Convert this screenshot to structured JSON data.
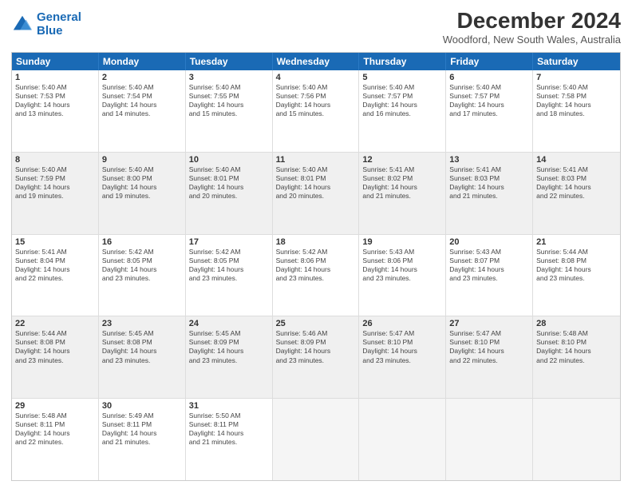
{
  "logo": {
    "line1": "General",
    "line2": "Blue"
  },
  "title": "December 2024",
  "subtitle": "Woodford, New South Wales, Australia",
  "days": [
    "Sunday",
    "Monday",
    "Tuesday",
    "Wednesday",
    "Thursday",
    "Friday",
    "Saturday"
  ],
  "rows": [
    [
      {
        "num": "1",
        "text": "Sunrise: 5:40 AM\nSunset: 7:53 PM\nDaylight: 14 hours\nand 13 minutes."
      },
      {
        "num": "2",
        "text": "Sunrise: 5:40 AM\nSunset: 7:54 PM\nDaylight: 14 hours\nand 14 minutes."
      },
      {
        "num": "3",
        "text": "Sunrise: 5:40 AM\nSunset: 7:55 PM\nDaylight: 14 hours\nand 15 minutes."
      },
      {
        "num": "4",
        "text": "Sunrise: 5:40 AM\nSunset: 7:56 PM\nDaylight: 14 hours\nand 15 minutes."
      },
      {
        "num": "5",
        "text": "Sunrise: 5:40 AM\nSunset: 7:57 PM\nDaylight: 14 hours\nand 16 minutes."
      },
      {
        "num": "6",
        "text": "Sunrise: 5:40 AM\nSunset: 7:57 PM\nDaylight: 14 hours\nand 17 minutes."
      },
      {
        "num": "7",
        "text": "Sunrise: 5:40 AM\nSunset: 7:58 PM\nDaylight: 14 hours\nand 18 minutes."
      }
    ],
    [
      {
        "num": "8",
        "text": "Sunrise: 5:40 AM\nSunset: 7:59 PM\nDaylight: 14 hours\nand 19 minutes.",
        "shaded": true
      },
      {
        "num": "9",
        "text": "Sunrise: 5:40 AM\nSunset: 8:00 PM\nDaylight: 14 hours\nand 19 minutes.",
        "shaded": true
      },
      {
        "num": "10",
        "text": "Sunrise: 5:40 AM\nSunset: 8:01 PM\nDaylight: 14 hours\nand 20 minutes.",
        "shaded": true
      },
      {
        "num": "11",
        "text": "Sunrise: 5:40 AM\nSunset: 8:01 PM\nDaylight: 14 hours\nand 20 minutes.",
        "shaded": true
      },
      {
        "num": "12",
        "text": "Sunrise: 5:41 AM\nSunset: 8:02 PM\nDaylight: 14 hours\nand 21 minutes.",
        "shaded": true
      },
      {
        "num": "13",
        "text": "Sunrise: 5:41 AM\nSunset: 8:03 PM\nDaylight: 14 hours\nand 21 minutes.",
        "shaded": true
      },
      {
        "num": "14",
        "text": "Sunrise: 5:41 AM\nSunset: 8:03 PM\nDaylight: 14 hours\nand 22 minutes.",
        "shaded": true
      }
    ],
    [
      {
        "num": "15",
        "text": "Sunrise: 5:41 AM\nSunset: 8:04 PM\nDaylight: 14 hours\nand 22 minutes."
      },
      {
        "num": "16",
        "text": "Sunrise: 5:42 AM\nSunset: 8:05 PM\nDaylight: 14 hours\nand 23 minutes."
      },
      {
        "num": "17",
        "text": "Sunrise: 5:42 AM\nSunset: 8:05 PM\nDaylight: 14 hours\nand 23 minutes."
      },
      {
        "num": "18",
        "text": "Sunrise: 5:42 AM\nSunset: 8:06 PM\nDaylight: 14 hours\nand 23 minutes."
      },
      {
        "num": "19",
        "text": "Sunrise: 5:43 AM\nSunset: 8:06 PM\nDaylight: 14 hours\nand 23 minutes."
      },
      {
        "num": "20",
        "text": "Sunrise: 5:43 AM\nSunset: 8:07 PM\nDaylight: 14 hours\nand 23 minutes."
      },
      {
        "num": "21",
        "text": "Sunrise: 5:44 AM\nSunset: 8:08 PM\nDaylight: 14 hours\nand 23 minutes."
      }
    ],
    [
      {
        "num": "22",
        "text": "Sunrise: 5:44 AM\nSunset: 8:08 PM\nDaylight: 14 hours\nand 23 minutes.",
        "shaded": true
      },
      {
        "num": "23",
        "text": "Sunrise: 5:45 AM\nSunset: 8:08 PM\nDaylight: 14 hours\nand 23 minutes.",
        "shaded": true
      },
      {
        "num": "24",
        "text": "Sunrise: 5:45 AM\nSunset: 8:09 PM\nDaylight: 14 hours\nand 23 minutes.",
        "shaded": true
      },
      {
        "num": "25",
        "text": "Sunrise: 5:46 AM\nSunset: 8:09 PM\nDaylight: 14 hours\nand 23 minutes.",
        "shaded": true
      },
      {
        "num": "26",
        "text": "Sunrise: 5:47 AM\nSunset: 8:10 PM\nDaylight: 14 hours\nand 23 minutes.",
        "shaded": true
      },
      {
        "num": "27",
        "text": "Sunrise: 5:47 AM\nSunset: 8:10 PM\nDaylight: 14 hours\nand 22 minutes.",
        "shaded": true
      },
      {
        "num": "28",
        "text": "Sunrise: 5:48 AM\nSunset: 8:10 PM\nDaylight: 14 hours\nand 22 minutes.",
        "shaded": true
      }
    ],
    [
      {
        "num": "29",
        "text": "Sunrise: 5:48 AM\nSunset: 8:11 PM\nDaylight: 14 hours\nand 22 minutes."
      },
      {
        "num": "30",
        "text": "Sunrise: 5:49 AM\nSunset: 8:11 PM\nDaylight: 14 hours\nand 21 minutes."
      },
      {
        "num": "31",
        "text": "Sunrise: 5:50 AM\nSunset: 8:11 PM\nDaylight: 14 hours\nand 21 minutes."
      },
      {
        "num": "",
        "text": "",
        "empty": true
      },
      {
        "num": "",
        "text": "",
        "empty": true
      },
      {
        "num": "",
        "text": "",
        "empty": true
      },
      {
        "num": "",
        "text": "",
        "empty": true
      }
    ]
  ]
}
